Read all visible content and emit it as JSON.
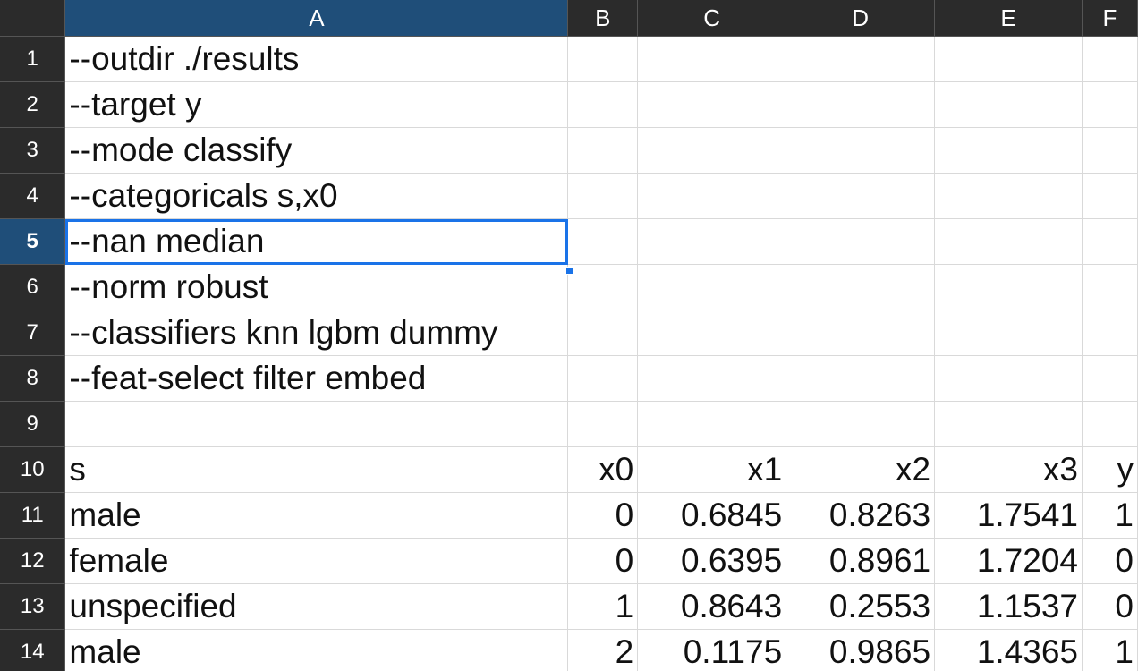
{
  "columns": [
    "A",
    "B",
    "C",
    "D",
    "E",
    "F"
  ],
  "active_column": "A",
  "active_row": "5",
  "rows": [
    {
      "num": "1",
      "cells": [
        "--outdir ./results",
        "",
        "",
        "",
        "",
        ""
      ]
    },
    {
      "num": "2",
      "cells": [
        "--target y",
        "",
        "",
        "",
        "",
        ""
      ]
    },
    {
      "num": "3",
      "cells": [
        "--mode classify",
        "",
        "",
        "",
        "",
        ""
      ]
    },
    {
      "num": "4",
      "cells": [
        "--categoricals s,x0",
        "",
        "",
        "",
        "",
        ""
      ]
    },
    {
      "num": "5",
      "cells": [
        "--nan median",
        "",
        "",
        "",
        "",
        ""
      ]
    },
    {
      "num": "6",
      "cells": [
        "--norm robust",
        "",
        "",
        "",
        "",
        ""
      ]
    },
    {
      "num": "7",
      "cells": [
        "--classifiers knn lgbm dummy",
        "",
        "",
        "",
        "",
        ""
      ]
    },
    {
      "num": "8",
      "cells": [
        "--feat-select filter embed",
        "",
        "",
        "",
        "",
        ""
      ]
    },
    {
      "num": "9",
      "cells": [
        "",
        "",
        "",
        "",
        "",
        ""
      ]
    },
    {
      "num": "10",
      "cells": [
        "s",
        "x0",
        "x1",
        "x2",
        "x3",
        "y"
      ]
    },
    {
      "num": "11",
      "cells": [
        "male",
        "0",
        "0.6845",
        "0.8263",
        "1.7541",
        "1"
      ]
    },
    {
      "num": "12",
      "cells": [
        "female",
        "0",
        "0.6395",
        "0.8961",
        "1.7204",
        "0"
      ]
    },
    {
      "num": "13",
      "cells": [
        "unspecified",
        "1",
        "0.8643",
        "0.2553",
        "1.1537",
        "0"
      ]
    },
    {
      "num": "14",
      "cells": [
        "male",
        "2",
        "0.1175",
        "0.9865",
        "1.4365",
        "1"
      ]
    }
  ],
  "colors": {
    "header_bg": "#2b2b2b",
    "active_header_bg": "#1f4e79",
    "selection_border": "#1a73e8",
    "gridline": "#d9d9d9"
  }
}
